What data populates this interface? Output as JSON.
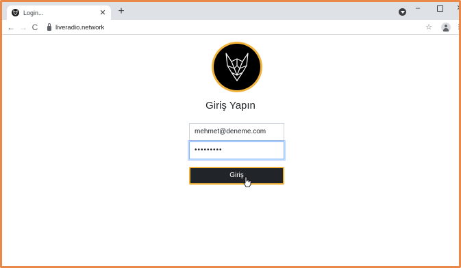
{
  "browser": {
    "tab": {
      "title": "Login..."
    },
    "url": "liveradio.network"
  },
  "icons": {
    "favicon": "wolf-logo-icon",
    "new_tab": "plus-icon",
    "close_tab": "close-icon",
    "back": "arrow-left-icon",
    "forward": "arrow-right-icon",
    "reload": "reload-icon",
    "lock": "lock-icon",
    "bookmark": "star-icon",
    "account": "account-icon",
    "menu": "kebab-menu-icon"
  },
  "login": {
    "title": "Giriş Yapın",
    "email_value": "mehmet@deneme.com",
    "password_value": "•••••••••",
    "submit_label": "Giriş"
  },
  "colors": {
    "frame_border": "#e8894a",
    "brand_gold": "#f1b33c",
    "button_dark": "#212529"
  }
}
